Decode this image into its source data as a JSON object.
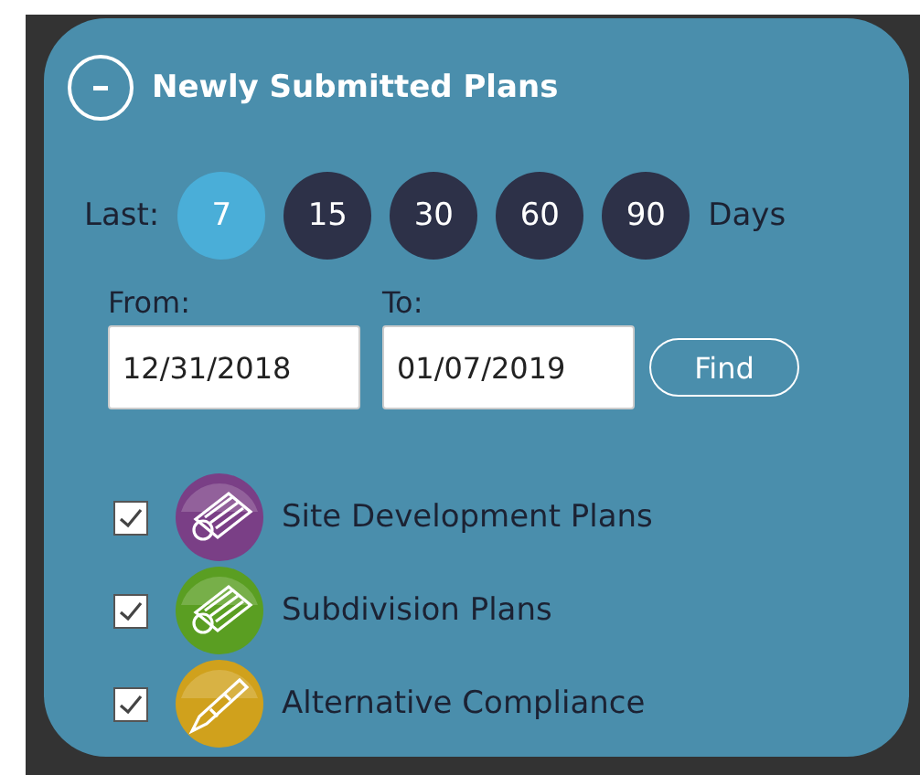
{
  "panel": {
    "title": "Newly Submitted Plans",
    "expanded": true
  },
  "days": {
    "label": "Last:",
    "unit": "Days",
    "options": [
      {
        "label": "7",
        "selected": true
      },
      {
        "label": "15",
        "selected": false
      },
      {
        "label": "30",
        "selected": false
      },
      {
        "label": "60",
        "selected": false
      },
      {
        "label": "90",
        "selected": false
      }
    ]
  },
  "range": {
    "from_label": "From:",
    "from_value": "12/31/2018",
    "to_label": "To:",
    "to_value": "01/07/2019",
    "find_button": "Find"
  },
  "layers": [
    {
      "label": "Site Development Plans",
      "checked": true,
      "kind": "plans",
      "color": "#7a3f86"
    },
    {
      "label": "Subdivision Plans",
      "checked": true,
      "kind": "plans",
      "color": "#5a9e22"
    },
    {
      "label": "Alternative Compliance",
      "checked": true,
      "kind": "pen",
      "color": "#d0a11c"
    }
  ]
}
